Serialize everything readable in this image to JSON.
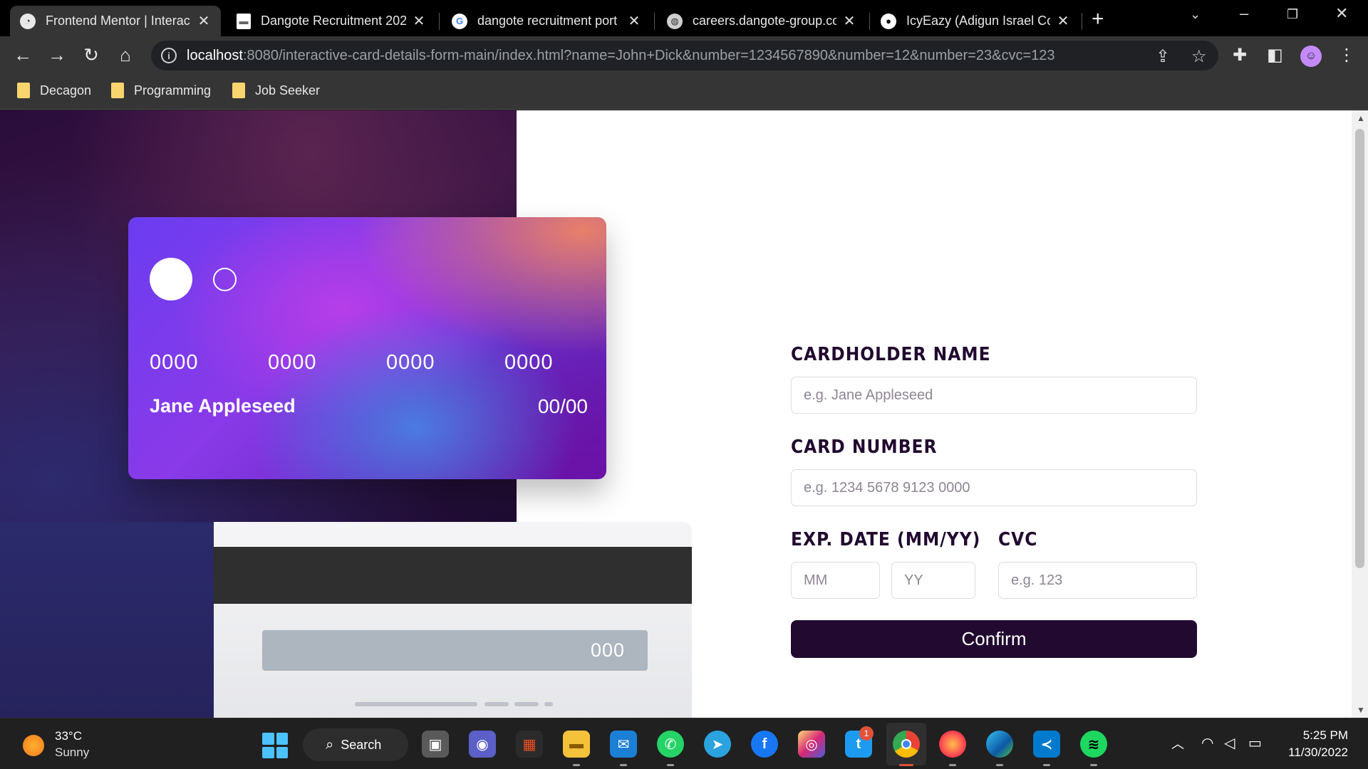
{
  "browser": {
    "tabs": [
      {
        "title": "Frontend Mentor | Interac",
        "favicon": "frontend-mentor-icon"
      },
      {
        "title": "Dangote Recruitment 202",
        "favicon": "document-icon"
      },
      {
        "title": "dangote recruitment port",
        "favicon": "google-icon"
      },
      {
        "title": "careers.dangote-group.co",
        "favicon": "globe-icon"
      },
      {
        "title": "IcyEazy (Adigun Israel Col",
        "favicon": "github-icon"
      }
    ],
    "url_host": "localhost",
    "url_rest": ":8080/interactive-card-details-form-main/index.html?name=John+Dick&number=1234567890&number=12&number=23&cvc=123",
    "bookmarks": [
      "Decagon",
      "Programming",
      "Job Seeker"
    ]
  },
  "card_front": {
    "number_groups": [
      "0000",
      "0000",
      "0000",
      "0000"
    ],
    "holder": "Jane Appleseed",
    "expiry": "00/00"
  },
  "card_back": {
    "cvc": "000"
  },
  "form": {
    "name_label": "CARDHOLDER NAME",
    "name_placeholder": "e.g. Jane Appleseed",
    "number_label": "CARD NUMBER",
    "number_placeholder": "e.g. 1234 5678 9123 0000",
    "exp_label": "EXP. DATE (MM/YY)",
    "mm_placeholder": "MM",
    "yy_placeholder": "YY",
    "cvc_label": "CVC",
    "cvc_placeholder": "e.g. 123",
    "confirm_label": "Confirm"
  },
  "taskbar": {
    "weather_temp": "33°C",
    "weather_desc": "Sunny",
    "search_label": "Search",
    "twitter_badge": "1",
    "time": "5:25 PM",
    "date": "11/30/2022"
  },
  "colors": {
    "dark_violet": "#21092f",
    "placeholder_gray": "#8e8593",
    "border_gray": "#dedddf"
  }
}
